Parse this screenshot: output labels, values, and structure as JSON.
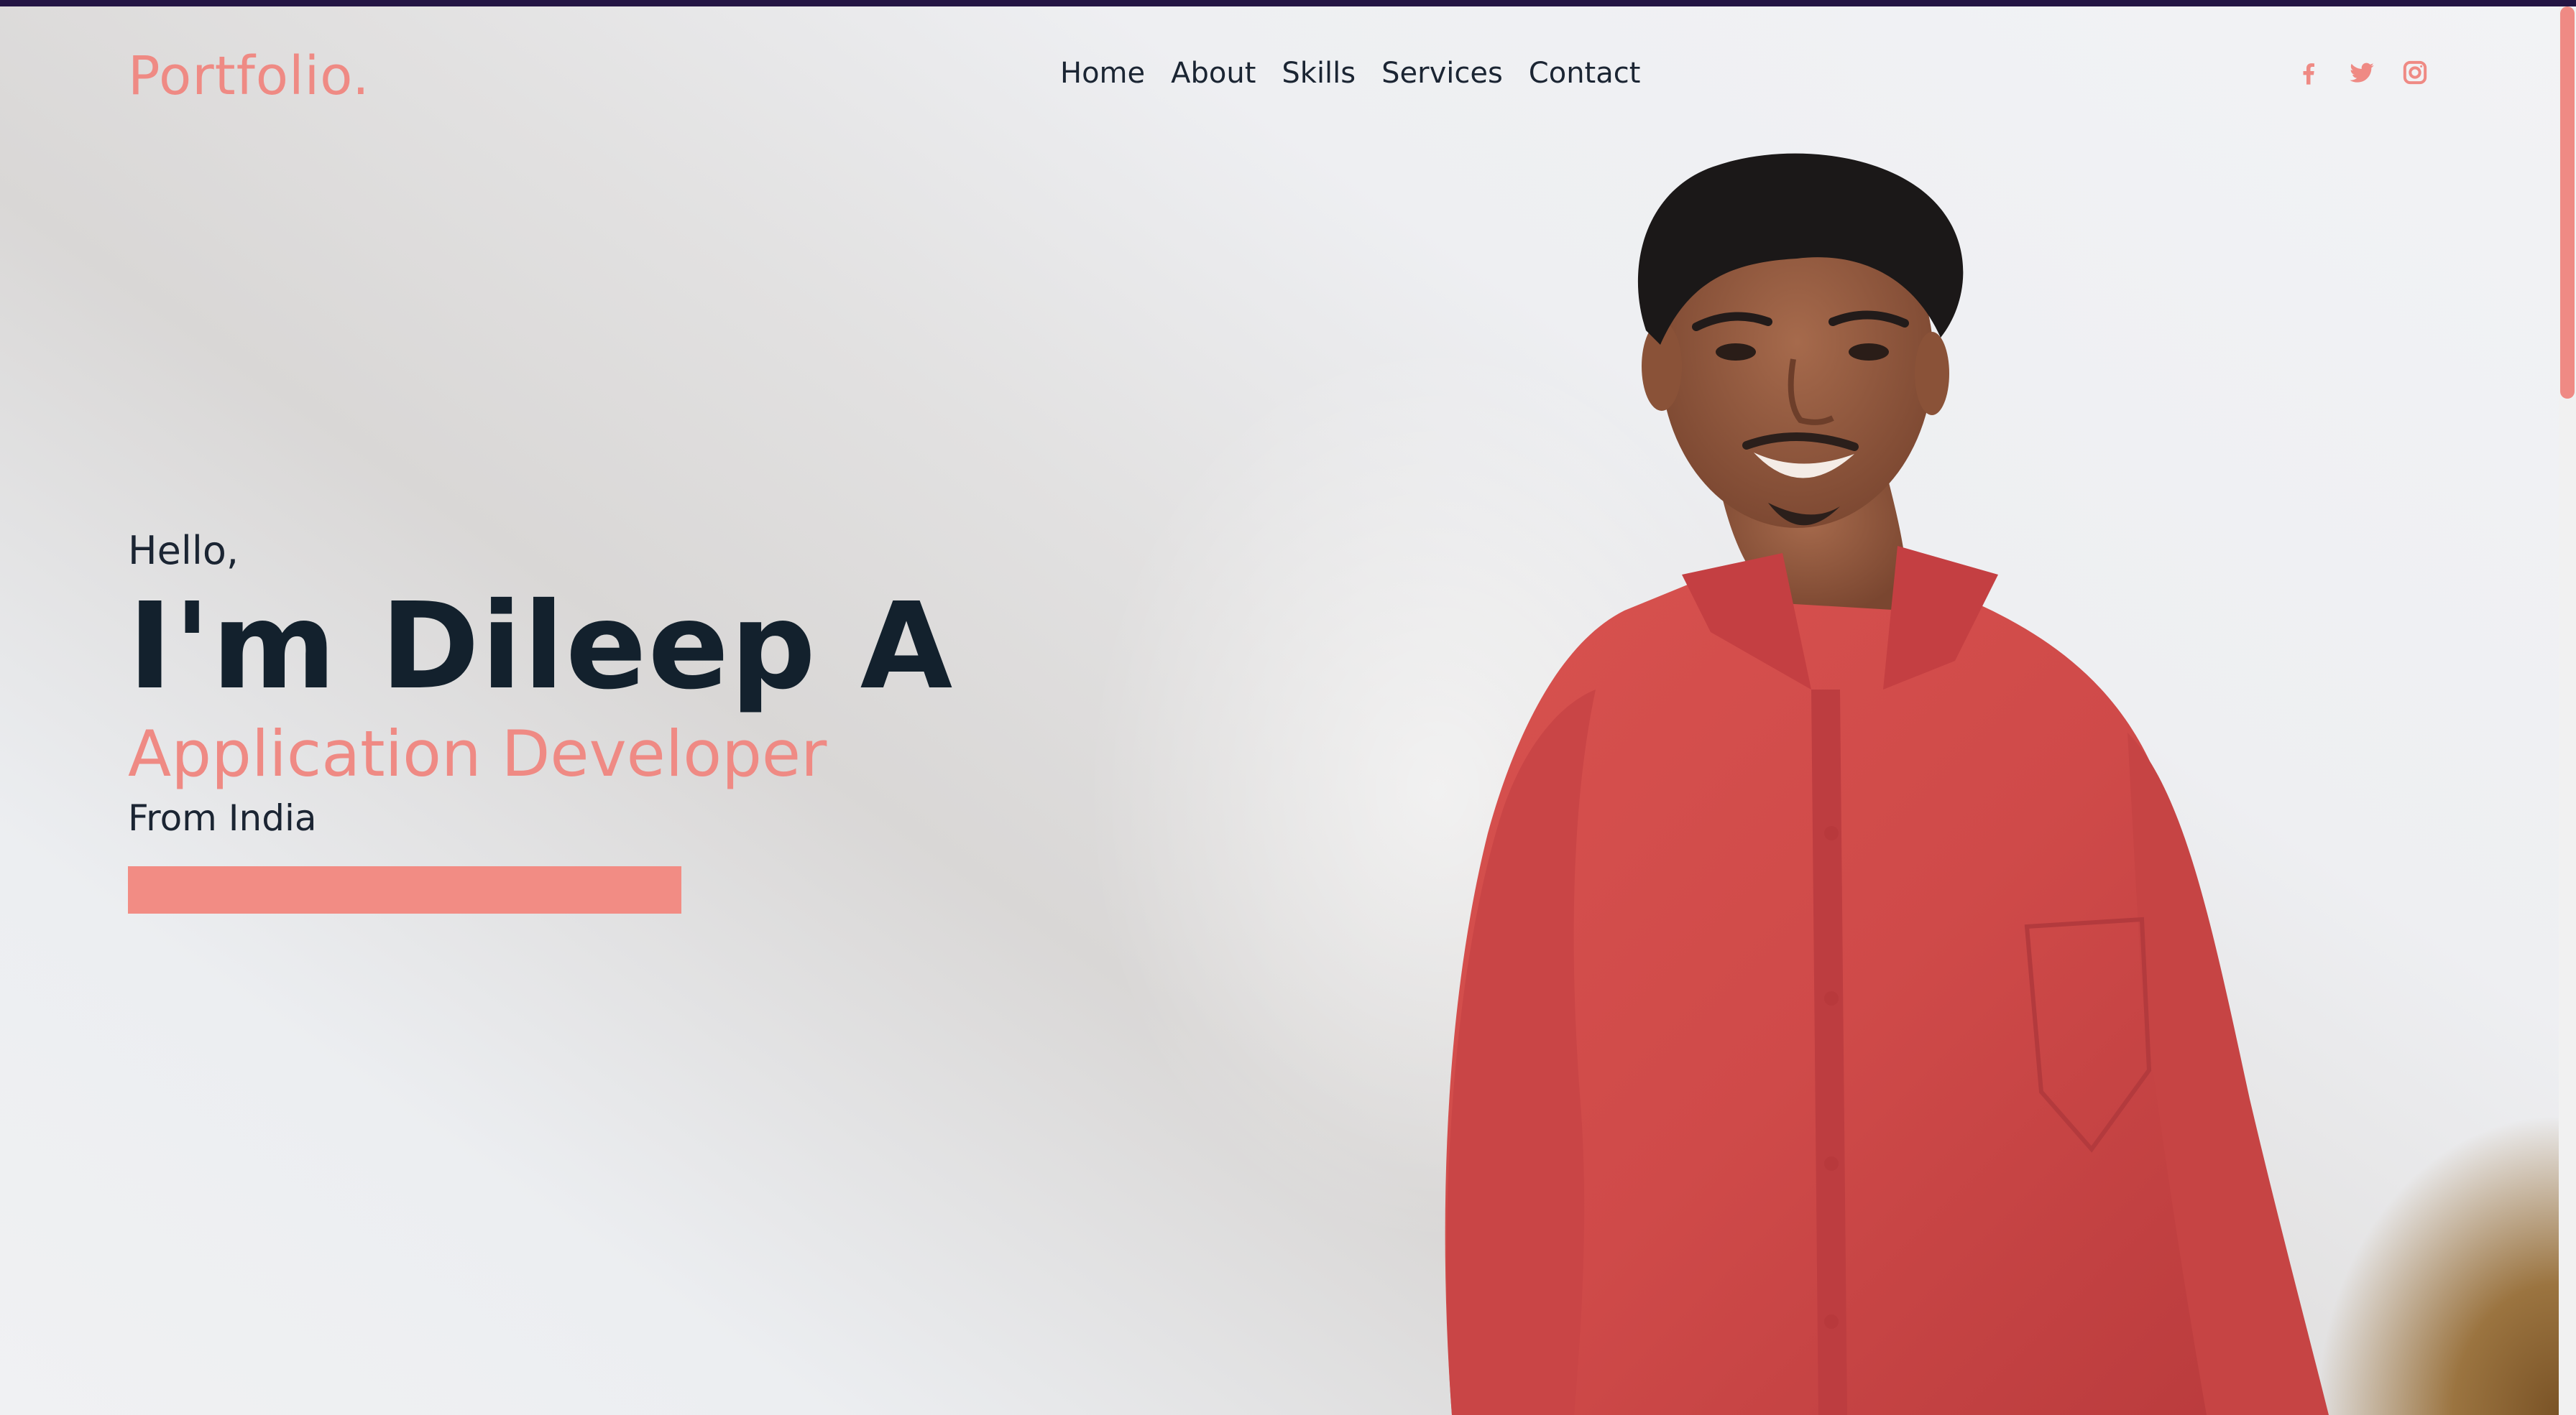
{
  "header": {
    "logo": "Portfolio.",
    "nav": [
      {
        "label": "Home"
      },
      {
        "label": "About"
      },
      {
        "label": "Skills"
      },
      {
        "label": "Services"
      },
      {
        "label": "Contact"
      }
    ],
    "social_icons": [
      "facebook-icon",
      "twitter-icon",
      "instagram-icon"
    ]
  },
  "hero": {
    "greeting": "Hello,",
    "name": "I'm Dileep A",
    "role": "Application Developer",
    "location": "From India"
  },
  "colors": {
    "accent": "#ef8a84",
    "text_dark": "#13212d",
    "top_bar": "#241544",
    "shirt": "#d24c4c"
  }
}
